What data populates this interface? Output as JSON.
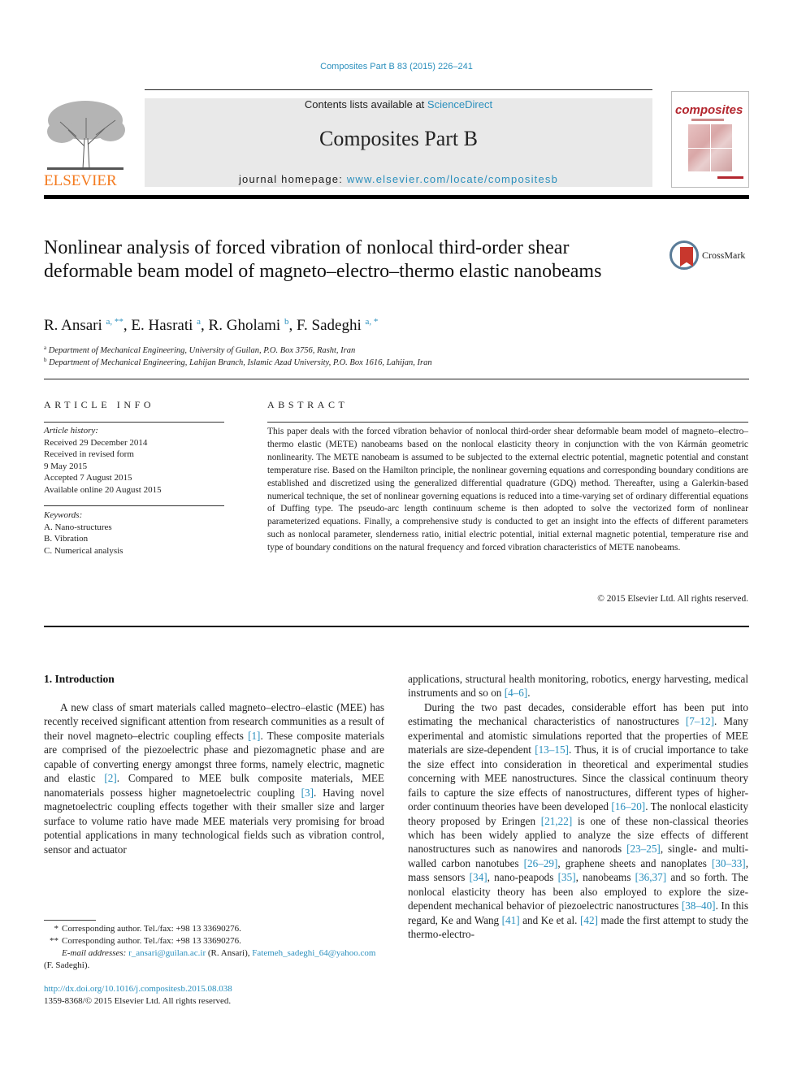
{
  "header": {
    "journal_ref": "Composites Part B 83 (2015) 226–241",
    "contents_prefix": "Contents lists available at ",
    "contents_link": "ScienceDirect",
    "journal_title": "Composites Part B",
    "homepage_prefix": "journal homepage: ",
    "homepage_link": "www.elsevier.com/locate/compositesb",
    "publisher_logo": "ELSEVIER",
    "cover_brand": "composites",
    "accent_color": "#2a8fbd",
    "publisher_color": "#f47b20"
  },
  "article": {
    "title": "Nonlinear analysis of forced vibration of nonlocal third-order shear deformable beam model of magneto–electro–thermo elastic nanobeams",
    "crossmark_label": "CrossMark",
    "authors": [
      {
        "name": "R. Ansari",
        "sup": "a, **",
        "sep": ", "
      },
      {
        "name": "E. Hasrati",
        "sup": "a",
        "sep": ", "
      },
      {
        "name": "R. Gholami",
        "sup": "b",
        "sep": ", "
      },
      {
        "name": "F. Sadeghi",
        "sup": "a, *",
        "sep": ""
      }
    ],
    "affiliations": [
      {
        "mark": "a",
        "text": "Department of Mechanical Engineering, University of Guilan, P.O. Box 3756, Rasht, Iran"
      },
      {
        "mark": "b",
        "text": "Department of Mechanical Engineering, Lahijan Branch, Islamic Azad University, P.O. Box 1616, Lahijan, Iran"
      }
    ]
  },
  "article_info": {
    "label": "ARTICLE INFO",
    "history_heading": "Article history:",
    "history": [
      "Received 29 December 2014",
      "Received in revised form",
      "9 May 2015",
      "Accepted 7 August 2015",
      "Available online 20 August 2015"
    ],
    "keywords_heading": "Keywords:",
    "keywords": [
      "A. Nano-structures",
      "B. Vibration",
      "C. Numerical analysis"
    ]
  },
  "abstract": {
    "label": "ABSTRACT",
    "text": "This paper deals with the forced vibration behavior of nonlocal third-order shear deformable beam model of magneto–electro–thermo elastic (METE) nanobeams based on the nonlocal elasticity theory in conjunction with the von Kármán geometric nonlinearity. The METE nanobeam is assumed to be sub­jected to the external electric potential, magnetic potential and constant temperature rise. Based on the Hamilton principle, the nonlinear governing equations and corresponding boundary conditions are established and discretized using the generalized differential quadrature (GDQ) method. Thereafter, using a Galerkin-based numerical technique, the set of nonlinear governing equations is reduced into a time-varying set of ordinary differential equations of Duffing type. The pseudo-arc length continuum scheme is then adopted to solve the vectorized form of nonlinear parameterized equations. Finally, a comprehensive study is conducted to get an insight into the effects of different parameters such as nonlocal parameter, slenderness ratio, initial electric potential, initial external magnetic potential, temperature rise and type of boundary conditions on the natural frequency and forced vibration char­acteristics of METE nanobeams.",
    "copyright": "© 2015 Elsevier Ltd. All rights reserved."
  },
  "introduction": {
    "heading": "1.  Introduction",
    "left_column": [
      {
        "t": "A new class of smart materials called magneto–electro–elastic (MEE) has recently received significant attention from research communities as a result of their novel magneto–electric coupling effects "
      },
      {
        "c": "[1]"
      },
      {
        "t": ". These composite materials are comprised of the piezo­electric phase and piezomagnetic phase and are capable of con­verting energy amongst three forms, namely electric, magnetic and elastic "
      },
      {
        "c": "[2]"
      },
      {
        "t": ". Compared to MEE bulk composite materials, MEE nanomaterials possess higher magnetoelectric coupling "
      },
      {
        "c": "[3]"
      },
      {
        "t": ". Having novel magnetoelectric coupling effects together with their smaller size and larger surface to volume ratio have made MEE materials very promising for broad potential applications in many techno­logical fields such as vibration control, sensor and actuator"
      }
    ],
    "right_column_cont": [
      {
        "t": "applications, structural health monitoring, robotics, energy har­vesting, medical instruments and so on "
      },
      {
        "c": "[4–6]"
      },
      {
        "t": "."
      }
    ],
    "right_column_para": [
      {
        "t": "During the two past decades, considerable effort has been put into estimating the mechanical characteristics of nanostructures "
      },
      {
        "c": "[7–12]"
      },
      {
        "t": ". Many experimental and atomistic simulations reported that the properties of MEE materials are size-dependent "
      },
      {
        "c": "[13–15]"
      },
      {
        "t": ". Thus, it is of crucial importance to take the size effect into consideration in theoretical and experimental studies concerning with MEE nanostructures. Since the classical continuum theory fails to capture the size effects of nanostructures, different types of higher-order continuum theories have been developed "
      },
      {
        "c": "[16–20]"
      },
      {
        "t": ". The nonlocal elasticity theory proposed by Eringen "
      },
      {
        "c": "[21,22]"
      },
      {
        "t": " is one of these non-classical theories which has been widely applied to analyze the size effects of different nanostructures such as nano­wires and nanorods "
      },
      {
        "c": "[23–25]"
      },
      {
        "t": ", single- and multi-walled carbon nanotubes "
      },
      {
        "c": "[26–29]"
      },
      {
        "t": ", graphene sheets and nanoplates "
      },
      {
        "c": "[30–33]"
      },
      {
        "t": ", mass sensors "
      },
      {
        "c": "[34]"
      },
      {
        "t": ", nano-peapods "
      },
      {
        "c": "[35]"
      },
      {
        "t": ", nanobeams "
      },
      {
        "c": "[36,37]"
      },
      {
        "t": " and so forth. The nonlocal elasticity theory has been also employed to explore the size-dependent mechanical behavior of piezoelectric nano­structures "
      },
      {
        "c": "[38–40]"
      },
      {
        "t": ". In this regard, Ke and Wang "
      },
      {
        "c": "[41]"
      },
      {
        "t": " and Ke et al. "
      },
      {
        "c": "[42]"
      },
      {
        "t": " made the first attempt to study the thermo-electro-"
      }
    ]
  },
  "footnotes": {
    "single_star": {
      "mark": "*",
      "text": "Corresponding author. Tel./fax: +98 13 33690276."
    },
    "double_star": {
      "mark": "**",
      "text": "Corresponding author. Tel./fax: +98 13 33690276."
    },
    "email_label": "E-mail addresses: ",
    "email1": "r_ansari@guilan.ac.ir",
    "email1_owner": " (R. Ansari), ",
    "email2": "Fatemeh_sadeghi_64@yahoo.com",
    "email2_owner": " (F. Sadeghi).",
    "doi": "http://dx.doi.org/10.1016/j.compositesb.2015.08.038",
    "issn": "1359-8368/© 2015 Elsevier Ltd. All rights reserved."
  }
}
